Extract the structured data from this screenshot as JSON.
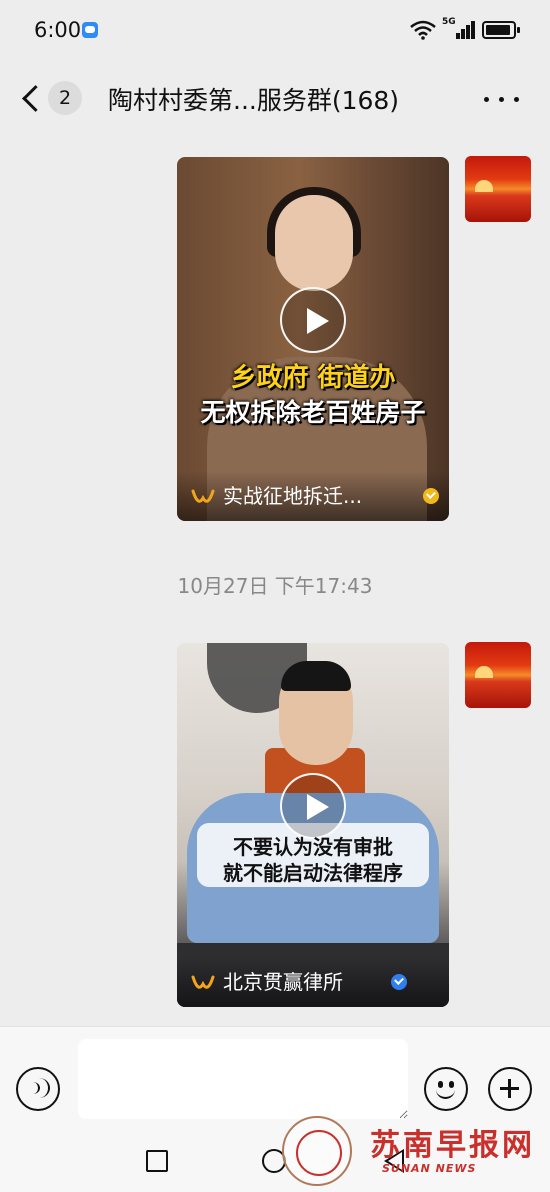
{
  "status_bar": {
    "time": "6:00",
    "network": "5G",
    "icons": [
      "message-notification-icon",
      "wifi-icon",
      "signal-icon",
      "battery-icon"
    ]
  },
  "header": {
    "unread_count": "2",
    "title": "陶村村委第...服务群(168)",
    "icons": [
      "back-chevron-icon",
      "more-dots-icon"
    ]
  },
  "messages": [
    {
      "type": "channels-video",
      "caption_line_1": "乡政府 街道办",
      "caption_line_2": "无权拆除老百姓房子",
      "channel_name": "实战征地拆迁...",
      "verified_color": "#f1b81c"
    },
    {
      "type": "timestamp",
      "text": "10月27日 下午17:43"
    },
    {
      "type": "channels-video",
      "caption_line_1": "不要认为没有审批",
      "caption_line_2": "就不能启动法律程序",
      "channel_name": "北京贯赢律所",
      "verified_color": "#2f7ff0"
    }
  ],
  "input_bar": {
    "icons": [
      "voice-icon",
      "emoji-icon",
      "plus-icon"
    ]
  },
  "system_nav": {
    "icons": [
      "recents-square-icon",
      "home-circle-icon",
      "back-triangle-icon"
    ]
  },
  "watermark": {
    "chinese": "苏南早报网",
    "english": "SUNAN NEWS"
  },
  "colors": {
    "background": "#ededed",
    "caption_yellow": "#ffd21a",
    "watermark_red": "#c9302c"
  }
}
